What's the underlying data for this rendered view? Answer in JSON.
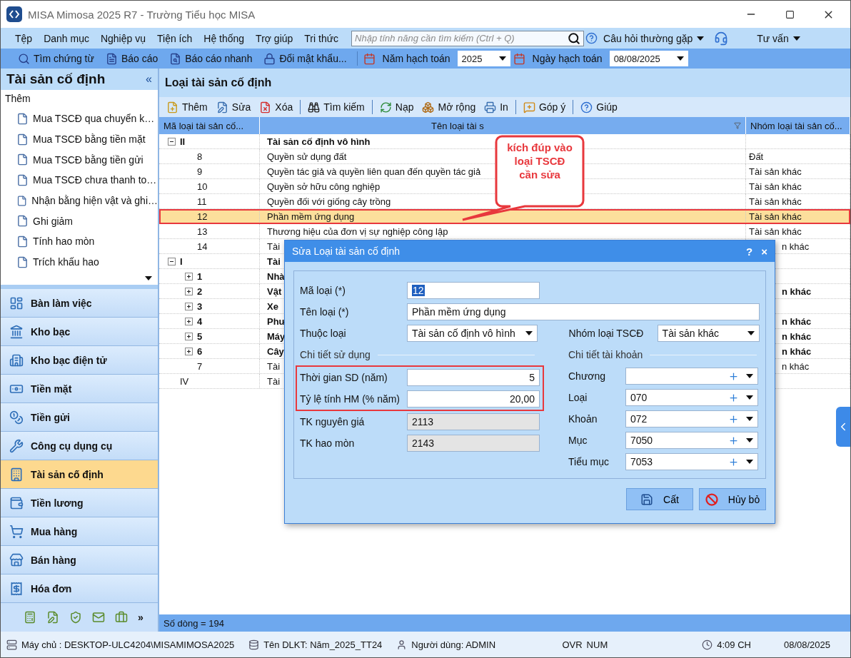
{
  "window": {
    "title": "MISA Mimosa 2025 R7 - Trường Tiểu học MISA"
  },
  "menu": [
    "Tệp",
    "Danh mục",
    "Nghiệp vụ",
    "Tiện ích",
    "Hệ thống",
    "Trợ giúp",
    "Tri thức"
  ],
  "feature_search": {
    "placeholder": "Nhập tính năng cần tìm kiếm (Ctrl + Q)"
  },
  "help_links": [
    "Câu hỏi thường gặp",
    "Tư vấn"
  ],
  "toolbar": {
    "buttons": [
      "Tìm chứng từ",
      "Báo cáo",
      "Báo cáo nhanh",
      "Đổi mật khẩu..."
    ],
    "fiscal_year": {
      "label": "Năm hạch toán",
      "value": "2025"
    },
    "posting_date": {
      "label": "Ngày hạch toán",
      "value": "08/08/2025"
    }
  },
  "sidebar": {
    "title": "Tài sản cố định",
    "collapse": "«",
    "task_group": "Thêm",
    "tasks": [
      "Mua TSCĐ qua chuyển k…",
      "Mua TSCĐ bằng tiền mặt",
      "Mua TSCĐ bằng tiền gửi",
      "Mua TSCĐ chưa thanh to…",
      "Nhận bằng hiện vật và ghi…",
      "Ghi giảm",
      "Tính hao mòn",
      "Trích khấu hao"
    ],
    "nav": [
      {
        "label": "Bàn làm việc",
        "selected": false
      },
      {
        "label": "Kho bạc",
        "selected": false
      },
      {
        "label": "Kho bạc điện tử",
        "selected": false
      },
      {
        "label": "Tiền mặt",
        "selected": false
      },
      {
        "label": "Tiền gửi",
        "selected": false
      },
      {
        "label": "Công cụ dụng cụ",
        "selected": false
      },
      {
        "label": "Tài sản cố định",
        "selected": true
      },
      {
        "label": "Tiền lương",
        "selected": false
      },
      {
        "label": "Mua hàng",
        "selected": false
      },
      {
        "label": "Bán hàng",
        "selected": false
      },
      {
        "label": "Hóa đơn",
        "selected": false
      }
    ],
    "more": "»"
  },
  "content": {
    "title": "Loại tài sản cố định",
    "toolbar": [
      "Thêm",
      "Sửa",
      "Xóa",
      "Tìm kiếm",
      "Nạp",
      "Mở rộng",
      "In",
      "Góp ý",
      "Giúp"
    ],
    "table": {
      "columns": [
        "Mã loại tài sản cố...",
        "Tên loại tài s",
        "Nhóm loại tài sản cố..."
      ],
      "rows": [
        {
          "code": "II",
          "name": "Tài sản cố định vô hình",
          "expanded": true,
          "selected": false,
          "children": [
            {
              "code": "8",
              "name": "Quyền sử dụng đất",
              "group": "Đất",
              "selected": false
            },
            {
              "code": "9",
              "name": "Quyền tác giả và quyền liên quan đến quyền tác giả",
              "group": "Tài sản khác",
              "selected": false
            },
            {
              "code": "10",
              "name": "Quyền sở hữu công nghiệp",
              "group": "Tài sản khác",
              "selected": false
            },
            {
              "code": "11",
              "name": "Quyền đối với giống cây trồng",
              "group": "Tài sản khác",
              "selected": false
            },
            {
              "code": "12",
              "name": "Phần mềm ứng dụng",
              "group": "Tài sản khác",
              "selected": true
            },
            {
              "code": "13",
              "name": "Thương hiệu của đơn vị sự nghiệp công lập",
              "group": "Tài sản khác",
              "selected": false
            },
            {
              "code": "14",
              "name": "Tài",
              "group": "n khác",
              "selected": false
            }
          ]
        },
        {
          "code": "I",
          "name": "Tài",
          "expanded": true,
          "selected": false,
          "children": [
            {
              "code": "1",
              "name": "Nhà",
              "expanded": false,
              "selected": false
            },
            {
              "code": "2",
              "name": "Vật",
              "group": "n khác",
              "expanded": false,
              "selected": false
            },
            {
              "code": "3",
              "name": "Xe",
              "expanded": false,
              "selected": false
            },
            {
              "code": "4",
              "name": "Phư",
              "group": "n khác",
              "expanded": false,
              "selected": false
            },
            {
              "code": "5",
              "name": "Máy",
              "group": "n khác",
              "expanded": false,
              "selected": false
            },
            {
              "code": "6",
              "name": "Cây",
              "group": "n khác",
              "expanded": false,
              "selected": false
            },
            {
              "code": "7",
              "name": "Tài",
              "group": "n khác",
              "selected": false
            }
          ]
        },
        {
          "code": "IV",
          "name": "Tài",
          "selected": false
        }
      ]
    },
    "row_count": "Số dòng = 194"
  },
  "callout": {
    "text": "kích đúp vào loại TSCĐ cần sửa"
  },
  "dialog": {
    "title": "Sửa Loại tài sản cố định",
    "help": "?",
    "close": "×",
    "code": {
      "label": "Mã loại (*)",
      "value": "12"
    },
    "name": {
      "label": "Tên loại (*)",
      "value": "Phần mềm ứng dụng"
    },
    "parent": {
      "label": "Thuộc loại",
      "value": "Tài sản cố định vô hình"
    },
    "group": {
      "label": "Nhóm loại TSCĐ",
      "value": "Tài sản khác"
    },
    "usage": {
      "title": "Chi tiết sử dụng",
      "highlighted": true,
      "fields": [
        {
          "label": "Thời gian SD (năm)",
          "value": "5"
        },
        {
          "label": "Tỷ lệ tính HM (% năm)",
          "value": "20,00"
        }
      ]
    },
    "accounts": [
      {
        "label": "TK nguyên giá",
        "value": "2113",
        "disabled": true
      },
      {
        "label": "TK hao mòn",
        "value": "2143",
        "disabled": true
      }
    ],
    "budget": {
      "title": "Chi tiết tài khoản",
      "fields": [
        {
          "label": "Chương"
        },
        {
          "label": "Loại",
          "value": "070"
        },
        {
          "label": "Khoản",
          "value": "072"
        },
        {
          "label": "Mục",
          "value": "7050"
        },
        {
          "label": "Tiểu mục",
          "value": "7053"
        }
      ]
    },
    "buttons": [
      "Cất",
      "Hủy bỏ"
    ]
  },
  "status_bar": {
    "server": "Máy chủ : DESKTOP-ULC4204\\MISAMIMOSA2025",
    "database": "Tên DLKT: Năm_2025_TT24",
    "user": "Người dùng: ADMIN",
    "modes": [
      "OVR",
      "NUM"
    ],
    "time": "4:09 CH",
    "date": "08/08/2025"
  }
}
